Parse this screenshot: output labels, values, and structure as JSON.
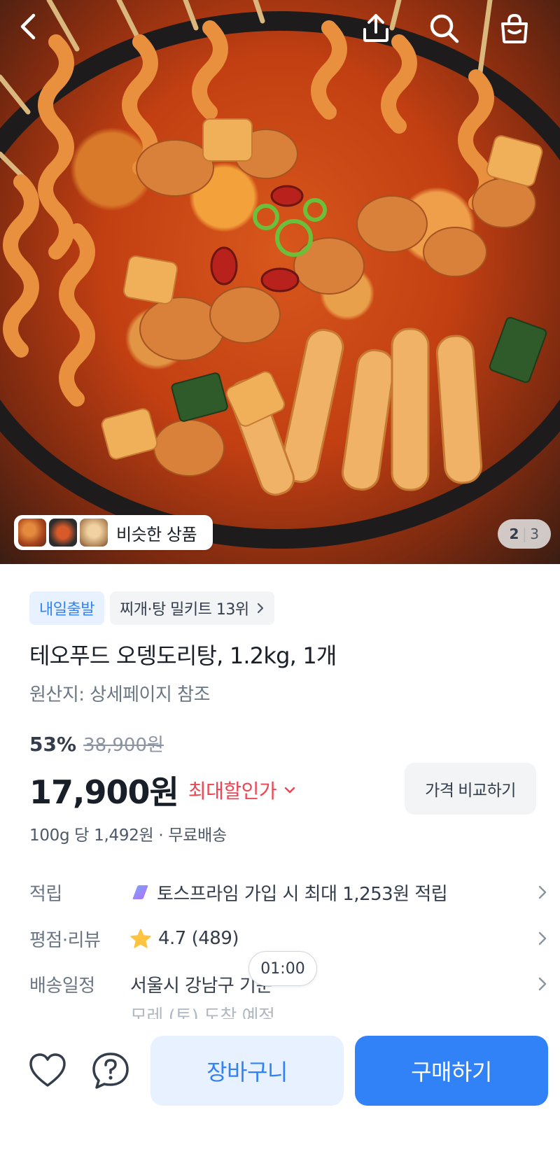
{
  "nav": {
    "back_icon": "chevron-left-icon",
    "share_icon": "share-icon",
    "search_icon": "search-icon",
    "cart_icon": "shopping-bag-icon"
  },
  "gallery": {
    "similar_label": "비슷한 상품",
    "current_page": "2",
    "total_pages": "3"
  },
  "product": {
    "badge_delivery": "내일출발",
    "badge_rank": "찌개·탕 밀키트 13위",
    "title": "테오푸드 오뎅도리탕, 1.2kg, 1개",
    "origin": "원산지: 상세페이지 참조",
    "discount_pct": "53%",
    "original_price": "38,900원",
    "price": "17,900원",
    "max_discount_label": "최대할인가",
    "compare_label": "가격 비교하기",
    "unit_price": "100g 당 1,492원 · 무료배송"
  },
  "info": {
    "points_label": "적립",
    "points_value": "토스프라임 가입 시 최대 1,253원 적립",
    "review_label": "평점·리뷰",
    "review_value": "4.7 (489)",
    "delivery_label": "배송일정",
    "delivery_value": "서울시 강남구 기준",
    "delivery_sub": "모레 (토) 도착 예정"
  },
  "timer": "01:00",
  "bottom": {
    "cart_label": "장바구니",
    "buy_label": "구매하기"
  },
  "colors": {
    "primary": "#3182f6",
    "primary_light": "#e8f1ff",
    "discount_red": "#f04452",
    "star": "#ffc342"
  }
}
